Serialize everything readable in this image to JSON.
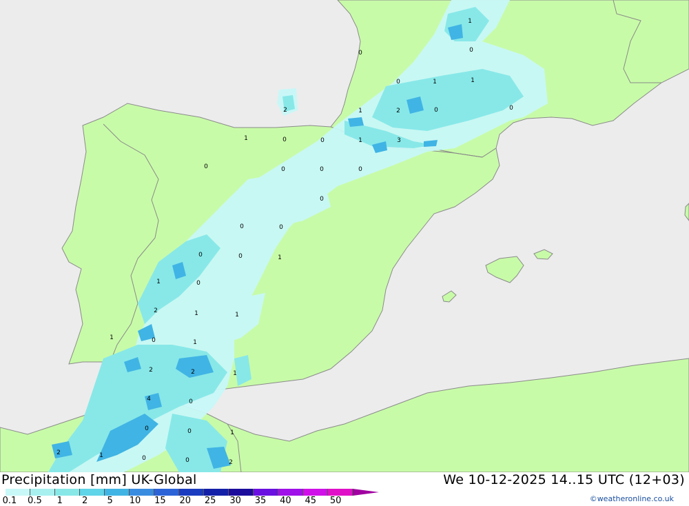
{
  "header": {
    "title": "Precipitation [mm] UK-Global",
    "datetime": "We 10-12-2025 14..15 UTC (12+03)",
    "credit": "©weatheronline.co.uk"
  },
  "colors": {
    "sea": "#ececec",
    "land": "#c8fba8",
    "coast": "#8a8a8a"
  },
  "colorbar": {
    "labels": [
      "0.1",
      "0.5",
      "1",
      "2",
      "5",
      "10",
      "15",
      "20",
      "25",
      "30",
      "35",
      "40",
      "45",
      "50"
    ],
    "colors": [
      "#c8f8f8",
      "#a8f0f0",
      "#88e8e8",
      "#60d4e8",
      "#40b4e4",
      "#3a8ce0",
      "#2c64d8",
      "#1c3cc0",
      "#1420a8",
      "#1c0c9c",
      "#6a10e0",
      "#a010e8",
      "#d010e8",
      "#e010c8",
      "#a000a0"
    ]
  },
  "map_labels": [
    {
      "text": "1"
    },
    {
      "text": "0"
    },
    {
      "text": "0"
    },
    {
      "text": "0"
    },
    {
      "text": "1"
    },
    {
      "text": "1"
    },
    {
      "text": "0"
    },
    {
      "text": "2"
    },
    {
      "text": "1"
    },
    {
      "text": "2"
    },
    {
      "text": "0"
    },
    {
      "text": "1"
    },
    {
      "text": "0"
    },
    {
      "text": "0"
    },
    {
      "text": "1"
    },
    {
      "text": "3"
    },
    {
      "text": "0"
    },
    {
      "text": "0"
    },
    {
      "text": "0"
    },
    {
      "text": "0"
    },
    {
      "text": "0"
    },
    {
      "text": "0"
    },
    {
      "text": "0"
    },
    {
      "text": "0"
    },
    {
      "text": "0"
    },
    {
      "text": "1"
    },
    {
      "text": "1"
    },
    {
      "text": "0"
    },
    {
      "text": "2"
    },
    {
      "text": "1"
    },
    {
      "text": "1"
    },
    {
      "text": "1"
    },
    {
      "text": "0"
    },
    {
      "text": "1"
    },
    {
      "text": "2"
    },
    {
      "text": "2"
    },
    {
      "text": "1"
    },
    {
      "text": "4"
    },
    {
      "text": "0"
    },
    {
      "text": "0"
    },
    {
      "text": "0"
    },
    {
      "text": "1"
    },
    {
      "text": "2"
    },
    {
      "text": "1"
    },
    {
      "text": "0"
    },
    {
      "text": "0"
    },
    {
      "text": "2"
    }
  ]
}
